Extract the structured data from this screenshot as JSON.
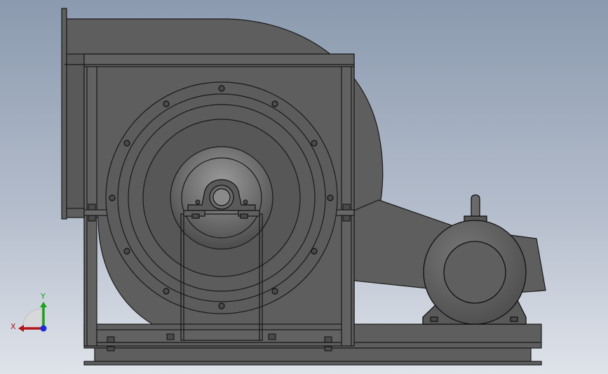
{
  "viewport": {
    "background_top": "#8b9aaf",
    "background_bottom": "#dfe3ea",
    "model_color": "#5e5e5e",
    "edge_color": "#1a1a1a"
  },
  "triad": {
    "x_label": "X",
    "y_label": "Y",
    "x_color": "#b0151c",
    "y_color": "#1aa31a",
    "z_color": "#1b2bd6"
  }
}
